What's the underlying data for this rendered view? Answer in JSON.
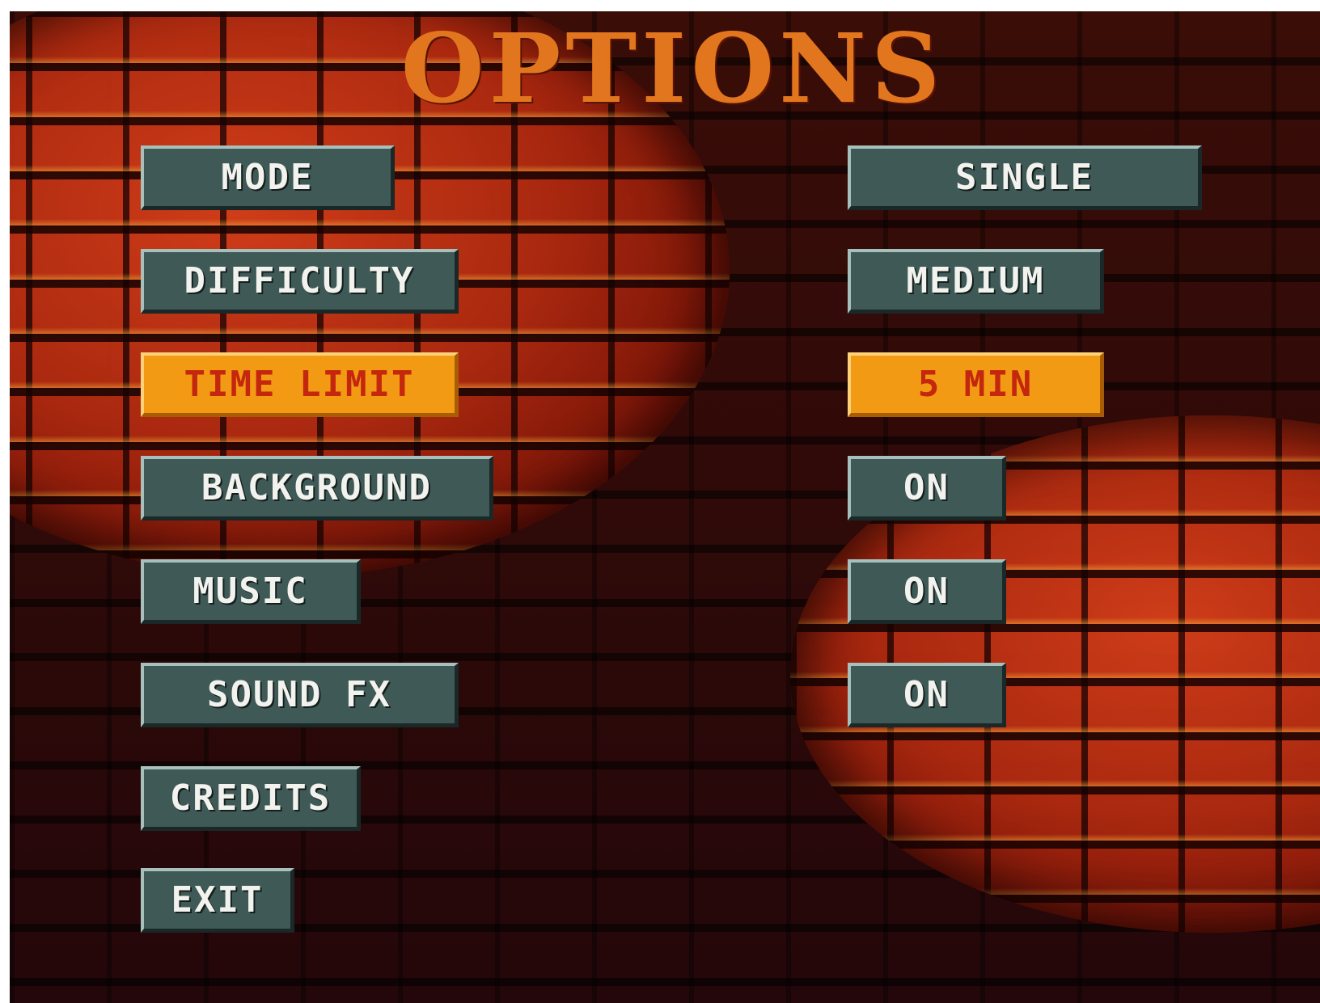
{
  "title": "OPTIONS",
  "colors": {
    "button_bg": "#3f5a56",
    "button_text": "#f2f2ee",
    "active_bg": "#f29a14",
    "active_text": "#c4260e",
    "title": "#e2761e"
  },
  "menu": {
    "mode": "MODE",
    "difficulty": "DIFFICULTY",
    "time_limit": "TIME LIMIT",
    "background": "BACKGROUND",
    "music": "MUSIC",
    "sound_fx": "SOUND FX",
    "credits": "CREDITS",
    "exit": "EXIT"
  },
  "values": {
    "mode": "SINGLE",
    "difficulty": "MEDIUM",
    "time_limit": "5 MIN",
    "background": "ON",
    "music": "ON",
    "sound_fx": "ON"
  },
  "selected_option": "time_limit"
}
